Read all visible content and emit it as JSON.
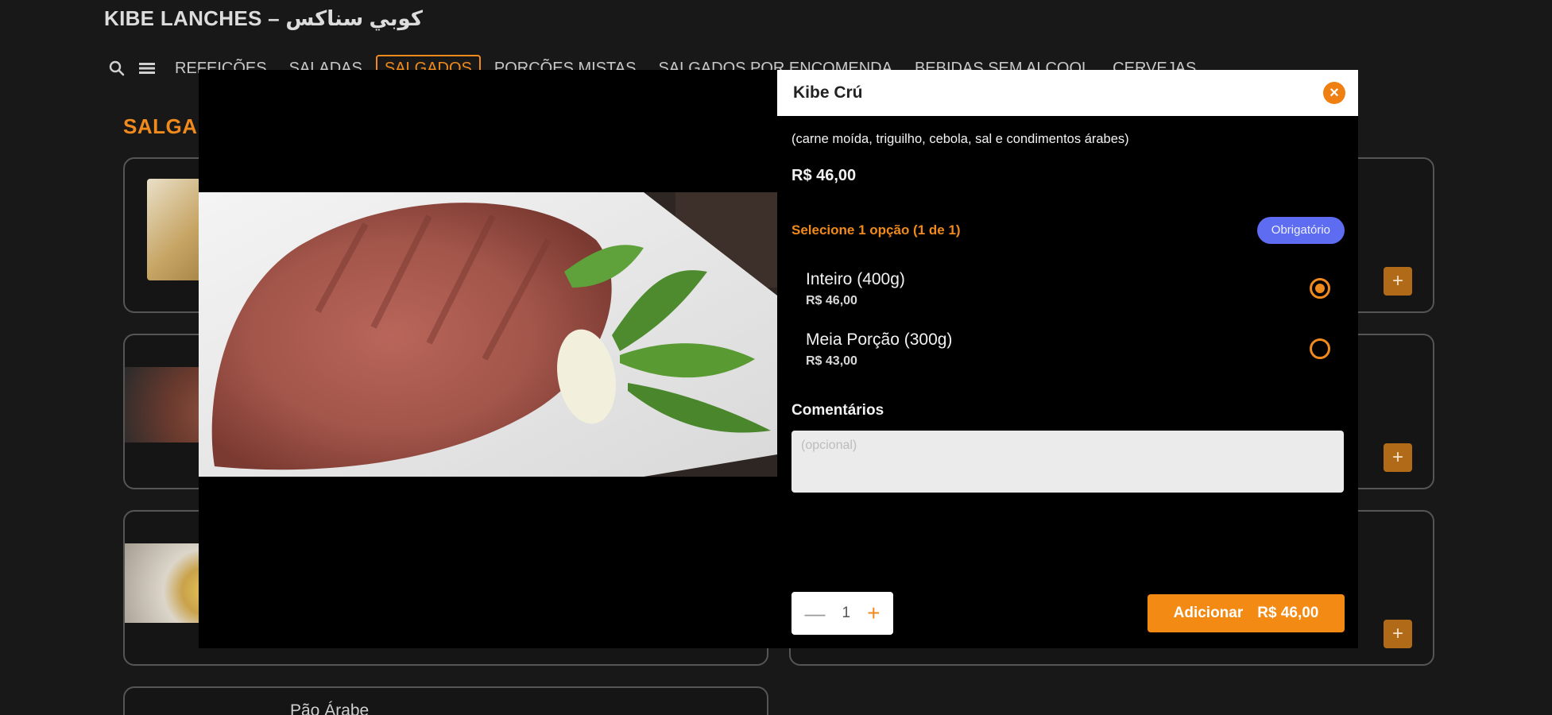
{
  "app": {
    "brand": "KIBE LANCHES – كوبي سناكس"
  },
  "nav": {
    "tabs": [
      {
        "label": "REFEIÇÕES"
      },
      {
        "label": "SALADAS"
      },
      {
        "label": "SALGADOS",
        "active": true
      },
      {
        "label": "PORÇÕES MISTAS"
      },
      {
        "label": "SALGADOS POR ENCOMENDA"
      },
      {
        "label": "BEBIDAS SEM ALCOOL"
      },
      {
        "label": "CERVEJAS"
      }
    ]
  },
  "section": {
    "title": "SALGA"
  },
  "background_cards": {
    "partial_label": "Pão Árabe"
  },
  "modal": {
    "title": "Kibe Crú",
    "description": "(carne moída, triguilho, cebola, sal e condimentos árabes)",
    "price": "R$ 46,00",
    "options_title": "Selecione 1 opção (1 de 1)",
    "required_badge": "Obrigatório",
    "options": [
      {
        "name": "Inteiro (400g)",
        "price": "R$ 46,00",
        "selected": true
      },
      {
        "name": "Meia Porção (300g)",
        "price": "R$ 43,00",
        "selected": false
      }
    ],
    "comments_label": "Comentários",
    "comments_placeholder": "(opcional)",
    "quantity": "1",
    "add_button_label": "Adicionar",
    "add_button_price": "R$ 46,00"
  },
  "colors": {
    "accent": "#f08a1c",
    "badge": "#5d6cf0",
    "background": "#181818"
  }
}
